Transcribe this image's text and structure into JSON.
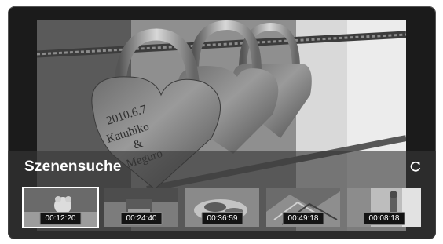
{
  "panel": {
    "title": "Szenensuche",
    "refresh_icon": "refresh-icon"
  },
  "thumbnails": [
    {
      "time": "00:12:20",
      "selected": true
    },
    {
      "time": "00:24:40",
      "selected": false
    },
    {
      "time": "00:36:59",
      "selected": false
    },
    {
      "time": "00:49:18",
      "selected": false
    },
    {
      "time": "00:08:18",
      "selected": false
    }
  ],
  "video": {
    "lock_engraving": [
      "2010.6.7",
      "Katuhiko",
      "&",
      "Meguro"
    ]
  },
  "colors": {
    "frame": "#1b1b1b",
    "panel": "#373737",
    "selected_border": "#ffffff"
  }
}
